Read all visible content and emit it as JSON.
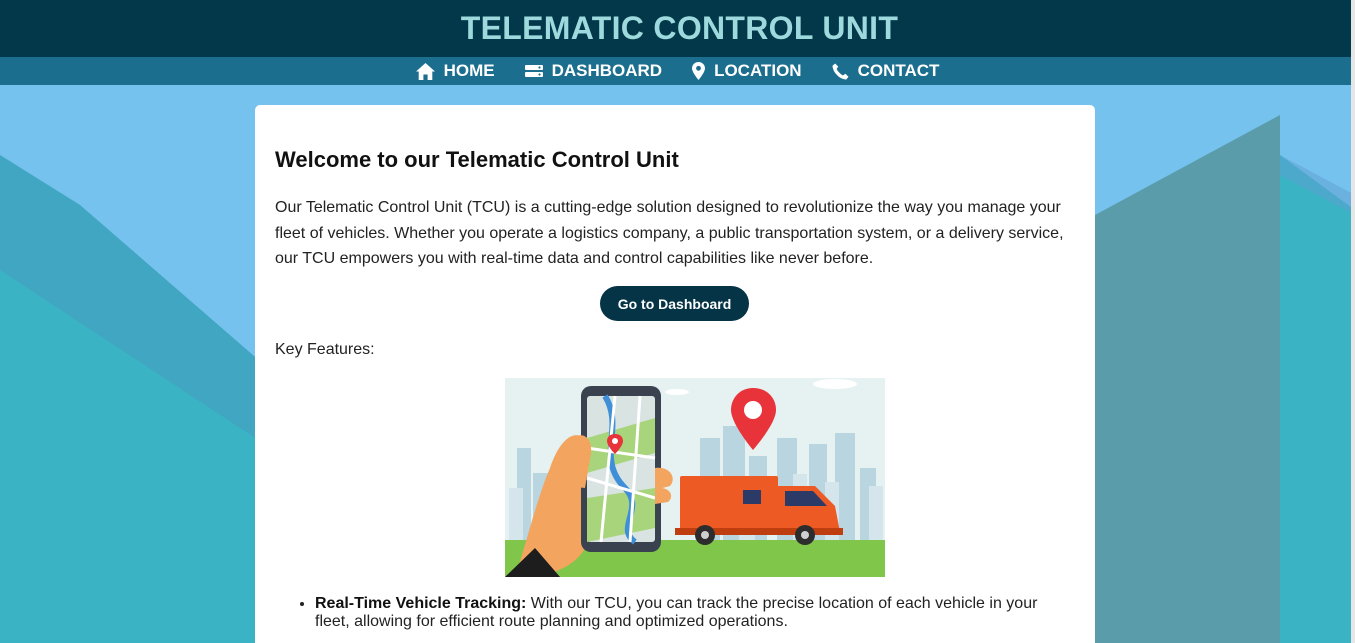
{
  "header": {
    "title": "TELEMATIC CONTROL UNIT"
  },
  "nav": {
    "items": [
      {
        "label": "HOME",
        "icon": "home-icon"
      },
      {
        "label": "DASHBOARD",
        "icon": "dashboard-icon"
      },
      {
        "label": "LOCATION",
        "icon": "location-pin-icon"
      },
      {
        "label": "CONTACT",
        "icon": "phone-icon"
      }
    ]
  },
  "main": {
    "heading": "Welcome to our Telematic Control Unit",
    "intro": "Our Telematic Control Unit (TCU) is a cutting-edge solution designed to revolutionize the way you manage your fleet of vehicles. Whether you operate a logistics company, a public transportation system, or a delivery service, our TCU empowers you with real-time data and control capabilities like never before.",
    "cta_label": "Go to Dashboard",
    "features_heading": "Key Features:",
    "features": [
      {
        "title": "Real-Time Vehicle Tracking:",
        "text": " With our TCU, you can track the precise location of each vehicle in your fleet, allowing for efficient route planning and optimized operations."
      }
    ]
  },
  "colors": {
    "header_bg": "#03384b",
    "header_text": "#9ed9dd",
    "nav_bg": "#1c6e8e",
    "page_bg": "#76c2ef",
    "teal_shape": "#3ab3c4",
    "button_bg": "#053446"
  }
}
